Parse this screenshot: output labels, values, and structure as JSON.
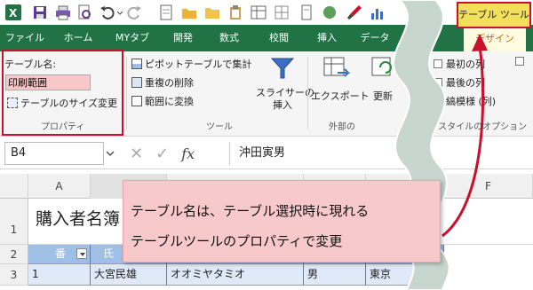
{
  "qat": {
    "icons": [
      "excel-icon",
      "save-icon",
      "print-icon",
      "preview-icon",
      "undo-icon",
      "redo-icon",
      "open-folder-icon",
      "folder-icon",
      "clipboard-icon",
      "sheet-icon",
      "record-icon",
      "brush-icon",
      "chart-icon",
      "table-icon"
    ]
  },
  "tabs": [
    "ファイル",
    "ホーム",
    "MYタブ",
    "開発",
    "数式",
    "校閲",
    "挿入",
    "データ"
  ],
  "context": {
    "header": "テーブル ツール",
    "tab": "デザイン"
  },
  "ribbon": {
    "table_name_label": "テーブル名:",
    "table_name_value": "印刷範囲",
    "resize_label": "テーブルのサイズ変更",
    "group_properties": "プロパティ",
    "pivot_label": "ピボットテーブルで集計",
    "dedupe_label": "重複の削除",
    "convert_label": "範囲に変換",
    "slicer_label": [
      "スライサーの",
      "挿入"
    ],
    "group_tools": "ツール",
    "export_label": "エクスポート",
    "refresh_label": "更新",
    "group_external": "外部の",
    "opt_first_col": "最初の列",
    "opt_last_col": "最後の列",
    "opt_banded": "縞模様 (列)",
    "group_style_options": "ブル スタイルのオプション"
  },
  "formula": {
    "cell_ref": "B4",
    "fx": "fx",
    "value": "沖田寅男"
  },
  "grid": {
    "col_headers": [
      "A",
      "B",
      "C",
      "D",
      "E",
      "F"
    ],
    "rows": [
      "1",
      "2",
      "3"
    ],
    "a1": "購入者名簿",
    "row2": [
      "番",
      "氏"
    ],
    "row3": [
      "1",
      "大宮民雄",
      "オオミヤタミオ",
      "男",
      "東京"
    ]
  },
  "callout": {
    "line1": "テーブル名は、テーブル選択時に現れる",
    "line2": "テーブルツールのプロパティで変更"
  },
  "colors": {
    "excel_green": "#217346",
    "callout_pink": "#f8c9cb",
    "arrow_red": "#c8112d",
    "context_yellow": "#f2df5c",
    "table_header": "#9fbfe6"
  }
}
